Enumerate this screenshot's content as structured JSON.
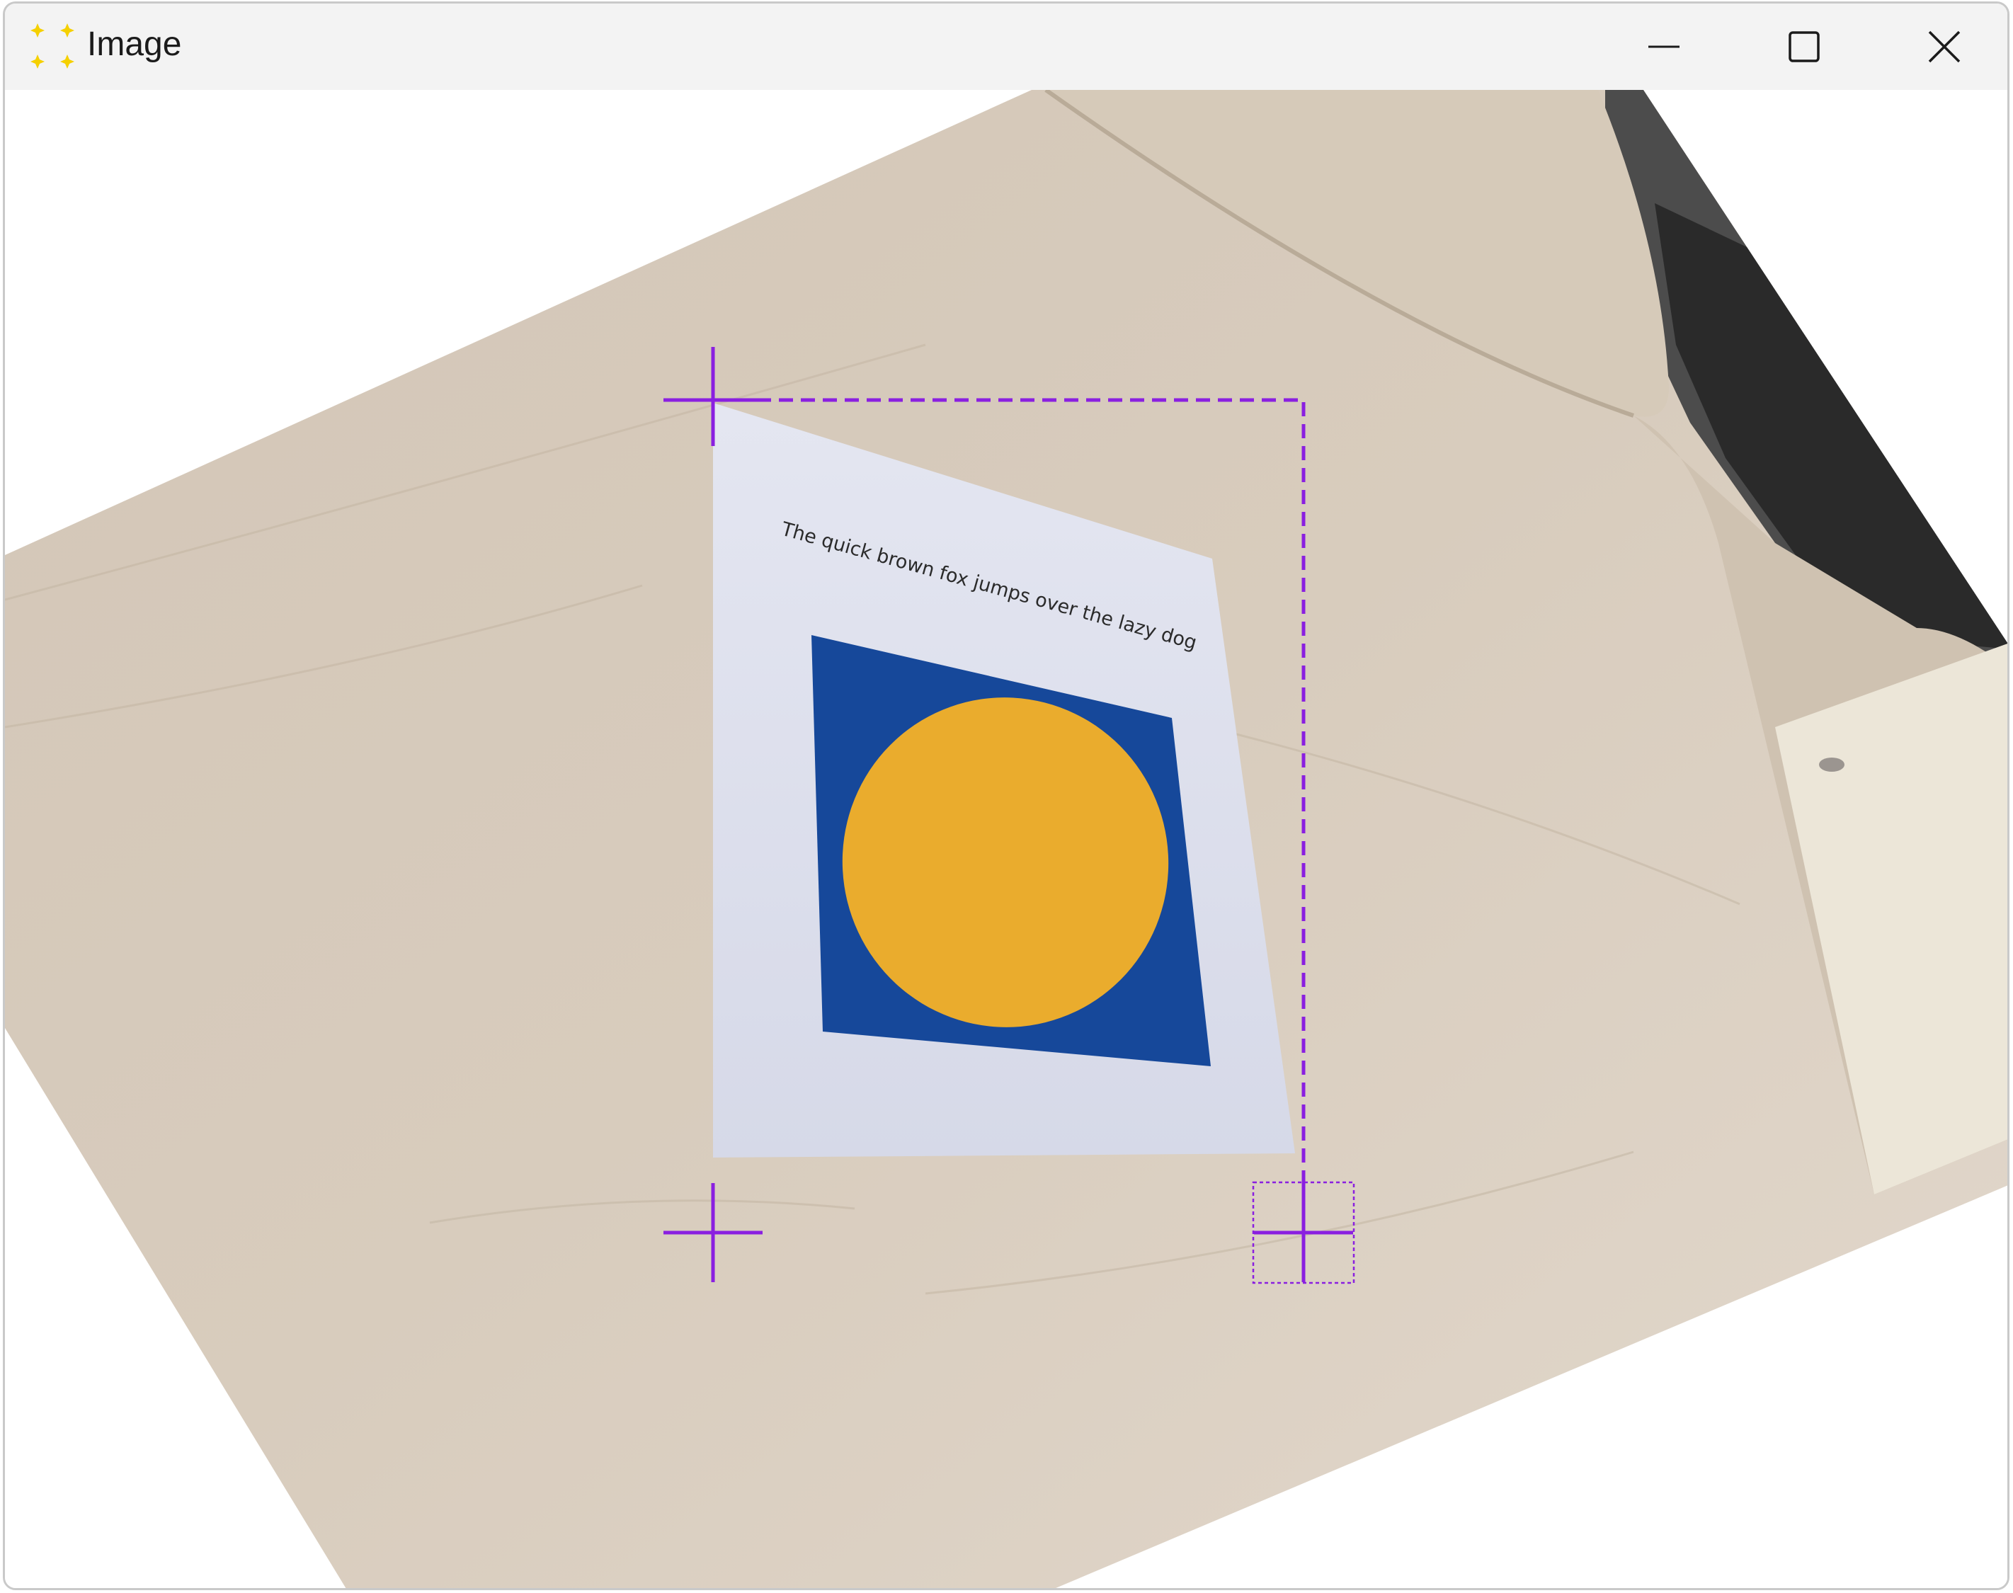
{
  "window": {
    "title": "Image",
    "app_icon": "four-yellow-dots-icon",
    "controls": {
      "minimize": "minimize-icon",
      "maximize": "maximize-icon",
      "close": "close-icon"
    }
  },
  "image": {
    "paper_text": "The quick brown fox jumps over the lazy dog"
  },
  "overlay": {
    "handles": [
      "top-left-corner-handle",
      "bottom-left-corner-handle",
      "bottom-right-corner-handle"
    ],
    "accent_color": "#8a1fe0",
    "selection_style": "dashed"
  },
  "colors": {
    "desk": "#d9cdbf",
    "paper": "#e1e3ef",
    "square": "#16489a",
    "circle": "#eaac2d",
    "titlebar": "#f3f3f3"
  }
}
